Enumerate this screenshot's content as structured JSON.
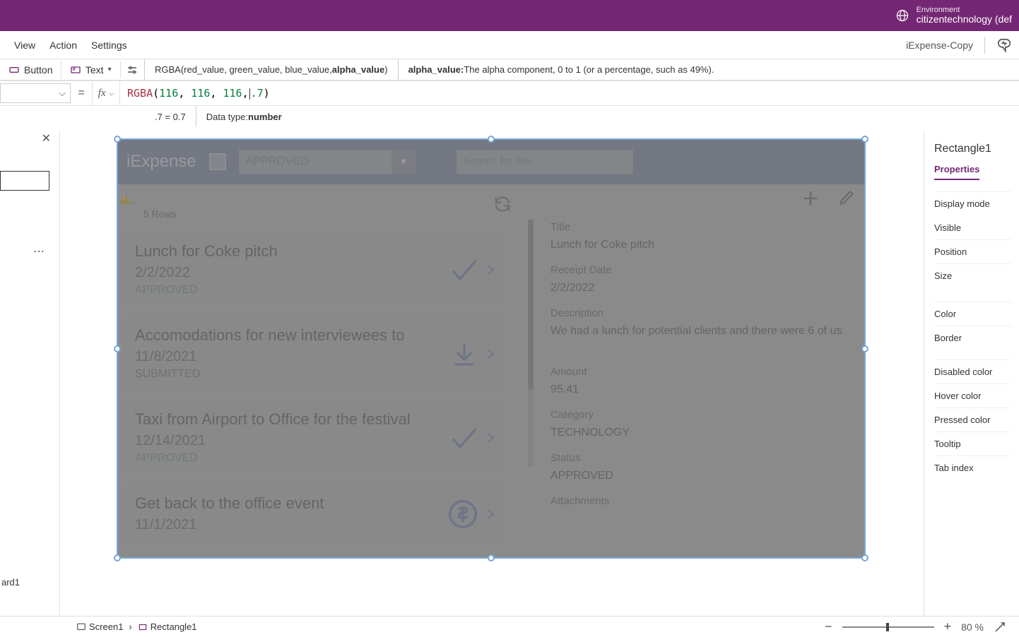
{
  "environment": {
    "label": "Environment",
    "value": "citizentechnology (def"
  },
  "menu": {
    "view": "View",
    "action": "Action",
    "settings": "Settings",
    "appName": "iExpense-Copy"
  },
  "toolbar": {
    "button": "Button",
    "text": "Text"
  },
  "hint": {
    "signature_pre": "RGBA(red_value, green_value, blue_value, ",
    "signature_bold": "alpha_value",
    "signature_post": ")",
    "param_name": "alpha_value:",
    "param_desc": " The alpha component, 0 to 1 (or a percentage, such as 49%)."
  },
  "formula": {
    "fn": "RGBA",
    "r": "116",
    "g": "116",
    "b": "116",
    "a": ".7",
    "fx": "fx"
  },
  "result": {
    "expr": ".7  =  0.7",
    "datatype_label": "Data type: ",
    "datatype_value": "number"
  },
  "tree": {
    "bottomItem": "ard1"
  },
  "app": {
    "title": "iExpense",
    "statusFilter": "APPROVED",
    "searchPlaceholder": "Search for title",
    "rowCount": "5 Rows",
    "items": [
      {
        "title": "Lunch for Coke pitch",
        "date": "2/2/2022",
        "status": "APPROVED",
        "statusClass": "green",
        "icon": "check"
      },
      {
        "title": "Accomodations for new interviewees to",
        "date": "11/8/2021",
        "status": "SUBMITTED",
        "statusClass": "",
        "icon": "download"
      },
      {
        "title": "Taxi from Airport to Office for the festival",
        "date": "12/14/2021",
        "status": "APPROVED",
        "statusClass": "green",
        "icon": "check"
      },
      {
        "title": "Get back to the office event",
        "date": "11/1/2021",
        "status": "",
        "statusClass": "",
        "icon": "dollar"
      }
    ],
    "detail": {
      "titleLabel": "Title",
      "titleValue": "Lunch for Coke pitch",
      "dateLabel": "Receipt Date",
      "dateValue": "2/2/2022",
      "descLabel": "Description",
      "descValue": "We had a lunch for potential clients and there were 6 of us",
      "amountLabel": "Amount",
      "amountValue": "95.41",
      "categoryLabel": "Category",
      "categoryValue": "TECHNOLOGY",
      "statusLabel": "Status",
      "statusValue": "APPROVED",
      "attachLabel": "Attachments"
    }
  },
  "rightPanel": {
    "name": "Rectangle1",
    "tabs": {
      "properties": "Properties"
    },
    "rows": {
      "displayMode": "Display mode",
      "visible": "Visible",
      "position": "Position",
      "size": "Size",
      "color": "Color",
      "border": "Border",
      "disabledColor": "Disabled color",
      "hoverColor": "Hover color",
      "pressedColor": "Pressed color",
      "tooltip": "Tooltip",
      "tabIndex": "Tab index"
    }
  },
  "bottom": {
    "screen": "Screen1",
    "rect": "Rectangle1",
    "zoomValue": "80",
    "zoomUnit": "%"
  }
}
